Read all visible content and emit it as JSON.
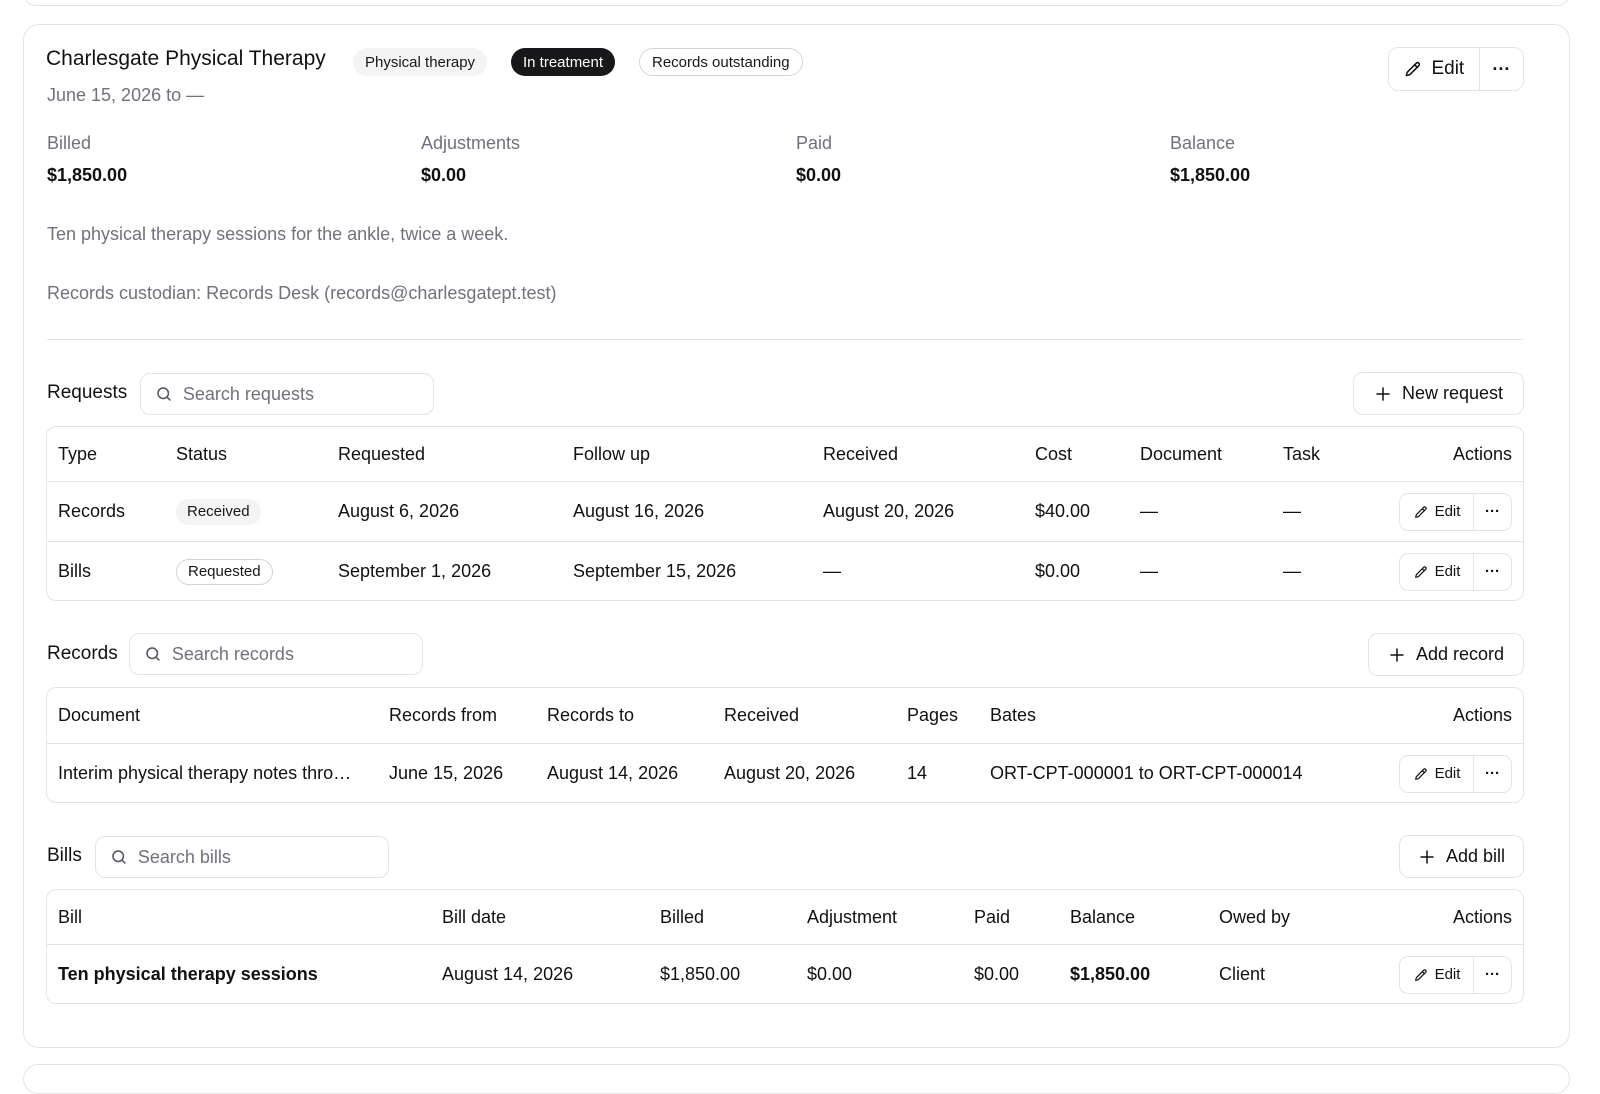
{
  "provider": {
    "name": "Charlesgate Physical Therapy",
    "badges": [
      "Physical therapy",
      "In treatment",
      "Records outstanding"
    ],
    "date_range": "June 15, 2026 to —",
    "edit_label": "Edit",
    "more_label": "···"
  },
  "summary": [
    {
      "label": "Billed",
      "value": "$1,850.00"
    },
    {
      "label": "Adjustments",
      "value": "$0.00"
    },
    {
      "label": "Paid",
      "value": "$0.00"
    },
    {
      "label": "Balance",
      "value": "$1,850.00"
    }
  ],
  "notes": {
    "description": "Ten physical therapy sessions for the ankle, twice a week.",
    "custodian": "Records custodian: Records Desk (records@charlesgatept.test)"
  },
  "requests": {
    "label": "Requests",
    "search_placeholder": "Search requests",
    "add_label": "New request",
    "columns": [
      "Type",
      "Status",
      "Requested",
      "Follow up",
      "Received",
      "Cost",
      "Document",
      "Task",
      "Actions"
    ],
    "rows": [
      {
        "type": "Records",
        "status": "Received",
        "requested": "August 6, 2026",
        "follow_up": "August 16, 2026",
        "received": "August 20, 2026",
        "cost": "$40.00",
        "document": "—",
        "task": "—"
      },
      {
        "type": "Bills",
        "status": "Requested",
        "requested": "September 1, 2026",
        "follow_up": "September 15, 2026",
        "received": "—",
        "cost": "$0.00",
        "document": "—",
        "task": "—"
      }
    ]
  },
  "records": {
    "label": "Records",
    "search_placeholder": "Search records",
    "add_label": "Add record",
    "columns": [
      "Document",
      "Records from",
      "Records to",
      "Received",
      "Pages",
      "Bates",
      "Actions"
    ],
    "rows": [
      {
        "document": "Interim physical therapy notes thro…",
        "from": "June 15, 2026",
        "to": "August 14, 2026",
        "received": "August 20, 2026",
        "pages": "14",
        "bates": "ORT-CPT-000001 to ORT-CPT-000014"
      }
    ]
  },
  "bills": {
    "label": "Bills",
    "search_placeholder": "Search bills",
    "add_label": "Add bill",
    "columns": [
      "Bill",
      "Bill date",
      "Billed",
      "Adjustment",
      "Paid",
      "Balance",
      "Owed by",
      "Actions"
    ],
    "rows": [
      {
        "bill": "Ten physical therapy sessions",
        "date": "August 14, 2026",
        "billed": "$1,850.00",
        "adjustment": "$0.00",
        "paid": "$0.00",
        "balance": "$1,850.00",
        "owed_by": "Client"
      }
    ]
  },
  "row_action": {
    "edit_label": "Edit",
    "more_label": "···"
  }
}
